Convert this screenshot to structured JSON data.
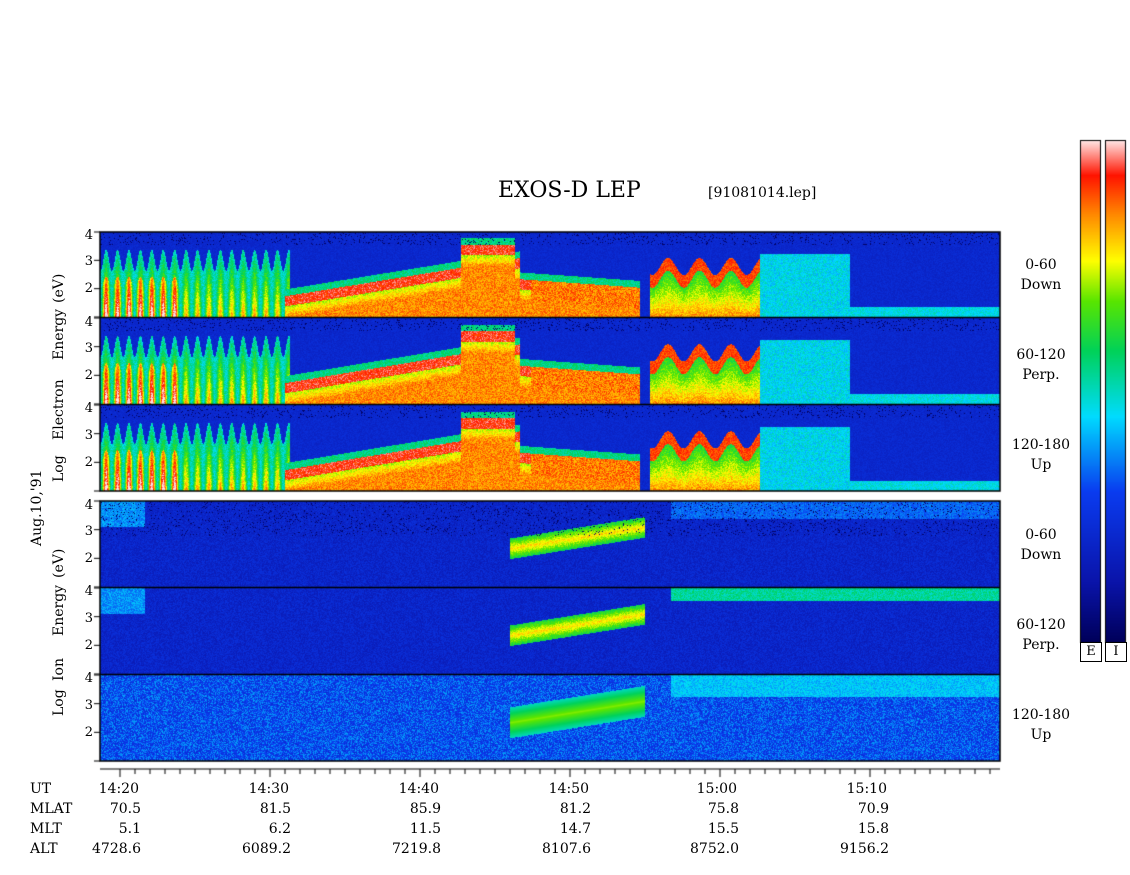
{
  "title": "EXOS-D LEP",
  "file": "[91081014.lep]",
  "date": "Aug.10,'91",
  "electron_ylabel": [
    "Log",
    "Electron",
    "Energy",
    "(eV)"
  ],
  "ion_ylabel": [
    "Log",
    "Ion",
    "Energy",
    "(eV)"
  ],
  "panels": [
    {
      "line1": "0-60",
      "line2": "Down"
    },
    {
      "line1": "60-120",
      "line2": "Perp."
    },
    {
      "line1": "120-180",
      "line2": "Up"
    },
    {
      "line1": "0-60",
      "line2": "Down"
    },
    {
      "line1": "60-120",
      "line2": "Perp."
    },
    {
      "line1": "120-180",
      "line2": "Up"
    }
  ],
  "colorbar_labels": [
    "E",
    "I"
  ],
  "row_labels": [
    "UT",
    "MLAT",
    "MLT",
    "ALT"
  ],
  "time_columns": [
    {
      "ut": "14:20",
      "mlat": "70.5",
      "mlt": "5.1",
      "alt": "4728.6"
    },
    {
      "ut": "14:30",
      "mlat": "81.5",
      "mlt": "6.2",
      "alt": "6089.2"
    },
    {
      "ut": "14:40",
      "mlat": "85.9",
      "mlt": "11.5",
      "alt": "7219.8"
    },
    {
      "ut": "14:50",
      "mlat": "81.2",
      "mlt": "14.7",
      "alt": "8107.6"
    },
    {
      "ut": "15:00",
      "mlat": "75.8",
      "mlt": "15.5",
      "alt": "8752.0"
    },
    {
      "ut": "15:10",
      "mlat": "70.9",
      "mlt": "15.8",
      "alt": "9156.2"
    }
  ],
  "yticks": [
    "4",
    "3",
    "2"
  ],
  "chart_data": {
    "type": "heatmap",
    "title": "EXOS-D LEP",
    "xlabel": "UT",
    "x_range_minutes": [
      14.3,
      15.3
    ],
    "ylabel_electron": "Log Electron Energy (eV)",
    "ylabel_ion": "Log Ion Energy (eV)",
    "ylim": [
      1,
      4
    ],
    "colormap": [
      "#ffffff",
      "#ff0000",
      "#ffa000",
      "#ffff00",
      "#00cc00",
      "#00ffff",
      "#0044ff",
      "#000066"
    ],
    "electron_panels": [
      "0-60 Down",
      "60-120 Perp.",
      "120-180 Up"
    ],
    "ion_panels": [
      "0-60 Down",
      "60-120 Perp.",
      "120-180 Up"
    ]
  }
}
